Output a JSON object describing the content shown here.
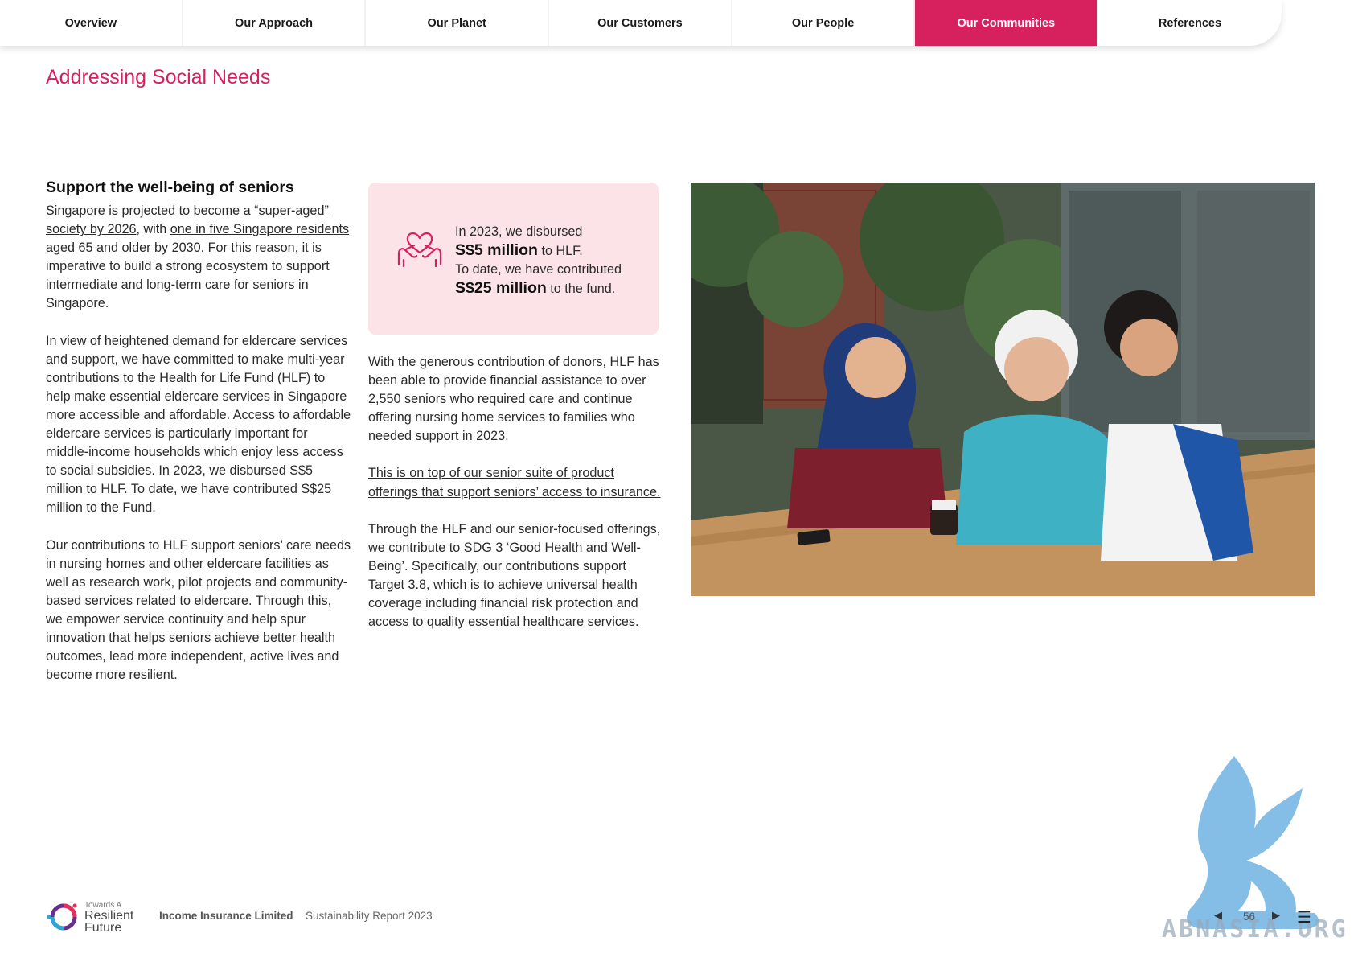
{
  "nav": {
    "tabs": [
      {
        "label": "Overview"
      },
      {
        "label": "Our Approach"
      },
      {
        "label": "Our Planet"
      },
      {
        "label": "Our Customers"
      },
      {
        "label": "Our People"
      },
      {
        "label": "Our Communities",
        "active": true
      },
      {
        "label": "References"
      }
    ]
  },
  "page": {
    "title": "Addressing Social Needs"
  },
  "left_column": {
    "heading": "Support the well-being of seniors",
    "p1_link1": "Singapore is projected to become a “super-aged” society by 2026",
    "p1_mid": ", with ",
    "p1_link2": "one in five Singapore residents aged 65 and older by 2030",
    "p1_rest": ". For this reason, it is imperative to build a strong ecosystem to support intermediate and long-term care for seniors in Singapore.",
    "p2": "In view of heightened demand for eldercare services and support, we have committed to make multi-year contributions to the Health for Life Fund (HLF) to help make essential eldercare services in Singapore more accessible and affordable. Access to affordable eldercare services is particularly important for middle-income households which enjoy less access to social subsidies. In 2023, we disbursed S$5 million to HLF. To date, we have contributed S$25 million to the Fund.",
    "p3": "Our contributions to HLF support seniors’ care needs in nursing homes and other eldercare facilities as well as research work, pilot projects and community-based services related to eldercare. Through this, we empower service continuity and help spur innovation that helps seniors achieve better health outcomes, lead more independent, active lives and become more resilient."
  },
  "highlight": {
    "icon": "hands-holding-heart-icon",
    "line1": "In 2023, we disbursed",
    "amount1": "S$5 million",
    "suffix1": " to HLF.",
    "line2": "To date, we have contributed",
    "amount2": "S$25 million",
    "suffix2": " to the fund."
  },
  "mid_column": {
    "p1": "With the generous contribution of donors, HLF has been able to provide financial assistance to over 2,550 seniors who required care and continue offering nursing home services to families who needed support in 2023.",
    "p2_link": "This is on top of our senior suite of product offerings that support seniors’ access to insurance.",
    "p3": "Through the HLF and our senior-focused offerings, we contribute to SDG 3 ‘Good Health and Well-Being’. Specifically, our contributions support Target 3.8, which is to achieve universal health coverage including financial risk protection and access to quality essential healthcare services."
  },
  "footer": {
    "tagline_small": "Towards A",
    "tagline_big1": "Resilient",
    "tagline_big2": "Future",
    "company": "Income Insurance Limited",
    "report": "Sustainability Report 2023"
  },
  "pager": {
    "page_number": "56",
    "prev_icon": "prev-arrow-icon",
    "next_icon": "next-arrow-icon",
    "menu_icon": "hamburger-menu-icon"
  },
  "watermark": {
    "text": "ABNASIA.ORG"
  },
  "colors": {
    "accent": "#d7205e",
    "highlight_bg": "#fbe3e8"
  }
}
